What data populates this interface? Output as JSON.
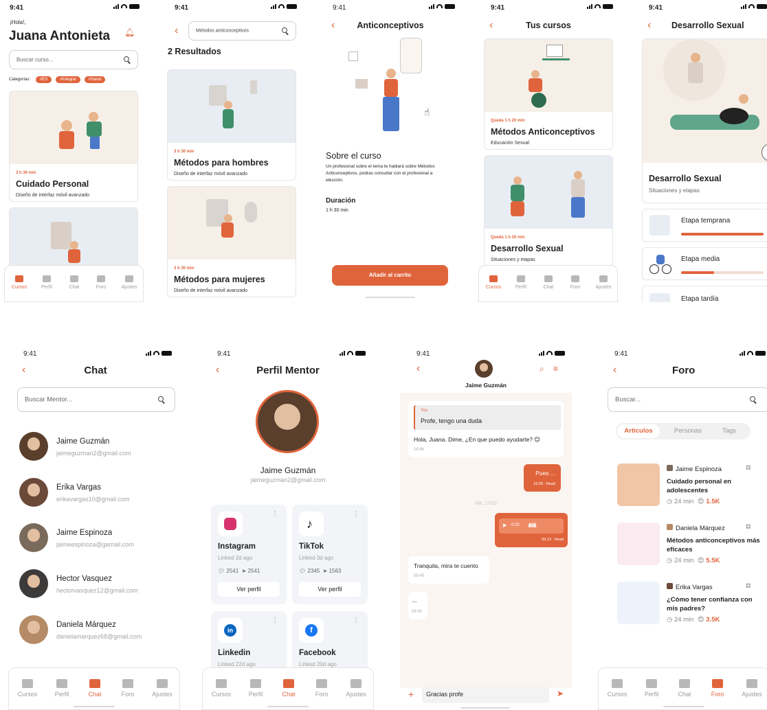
{
  "status_time": "9:41",
  "screens": {
    "home": {
      "greeting": "¡Hola!,",
      "name": "Juana Antonieta",
      "search_placeholder": "Buscar curso...",
      "categories_label": "Categorías:",
      "tags": [
        "#ES",
        "#Integral",
        "#Salud"
      ],
      "course": {
        "duration": "3 h 30 min",
        "title": "Cuidado Personal",
        "subtitle": "Diseño de interfaz móvil avanzado"
      }
    },
    "results": {
      "search_value": "Métodos anticonceptivos",
      "results_title": "2 Resultados",
      "cards": [
        {
          "duration": "3 h 30 min",
          "title": "Métodos para hombres",
          "subtitle": "Diseño de interfaz móvil avanzado"
        },
        {
          "duration": "3 h 30 min",
          "title": "Métodos para mujeres",
          "subtitle": "Diseño de interfaz móvil avanzado"
        }
      ]
    },
    "detail": {
      "title": "Anticonceptivos",
      "about_title": "Sobre el curso",
      "about_text": "Un profesional sobre el tema te hablará sobre Métodos Anticonceptivos, podras consultar con el profesional a elección.",
      "duration_title": "Duración",
      "duration_value": "1 h 30 min",
      "cta": "Añadir al carrito"
    },
    "my_courses": {
      "title": "Tus cursos",
      "cards": [
        {
          "remaining": "Queda 1 h 20 min",
          "title": "Métodos Anticonceptivos",
          "subtitle": "Educación Sexual"
        },
        {
          "remaining": "Queda 1 h 20 min",
          "title": "Desarrollo Sexual",
          "subtitle": "Situaciones y etapas"
        }
      ]
    },
    "development": {
      "title": "Desarrollo Sexual",
      "card_title": "Desarrollo Sexual",
      "card_subtitle": "Situaciones y etapas",
      "stages": [
        {
          "label": "Etapa temprana",
          "progress": 1.0
        },
        {
          "label": "Etapa media",
          "progress": 0.4
        },
        {
          "label": "Etapa tardía",
          "progress": 0
        }
      ]
    },
    "chat": {
      "title": "Chat",
      "search_placeholder": "Buscar Mentor...",
      "mentors": [
        {
          "name": "Jaime Guzmán",
          "email": "jaimeguzman2@gmail.com"
        },
        {
          "name": "Erika Vargas",
          "email": "erikavargas10@gmail.com"
        },
        {
          "name": "Jaime Espinoza",
          "email": "jaimeespinoza@gamail.com"
        },
        {
          "name": "Hector Vasquez",
          "email": "hectorvasquez12@gmail.com"
        },
        {
          "name": "Daniela Márquez",
          "email": "danielamarquez68@gmail.com"
        }
      ]
    },
    "profile": {
      "title": "Perfil Mentor",
      "name": "Jaime Guzmán",
      "email": "jaimeguzman2@gmail.com",
      "socials": [
        {
          "name": "Instagram",
          "linked": "Linked 2d ago",
          "comments": "2541",
          "shares": "2541",
          "button": "Ver perfil",
          "color": "#d6336c"
        },
        {
          "name": "TikTok",
          "linked": "Linked 3d ago",
          "comments": "2345",
          "shares": "1563",
          "button": "Ver perfil",
          "color": "#111111"
        },
        {
          "name": "Linkedin",
          "linked": "Linked 22d ago",
          "color": "#0a66c2"
        },
        {
          "name": "Facebook",
          "linked": "Linked 20d ago",
          "color": "#1877f2"
        }
      ]
    },
    "conversation": {
      "contact": "Jaime Guzmán",
      "quote_label": "You",
      "quote_text": "Profe, tengo una duda",
      "reply": "Hola, Juana. Dime, ¿En que puedo ayudarte? 😊",
      "reply_time": "16:46",
      "sent_text": "Pues ...",
      "sent_time": "16.50 · Read",
      "day_divider": "Vie, 17/10",
      "audio_time": "0:20",
      "audio_meta": "09.13 · Read",
      "msg2": "Tranquila, mira te cuento",
      "msg2_time": "09.45",
      "typing": "...",
      "typing_time": "09.45",
      "input_value": "Gracias profe"
    },
    "forum": {
      "title": "Foro",
      "search_placeholder": "Buscar...",
      "tabs": [
        "Articulos",
        "Personas",
        "Tags"
      ],
      "items": [
        {
          "author": "Jaime Espinoza",
          "title": "Cuidado personal en adolescentes",
          "time": "24 min",
          "likes": "1.5K"
        },
        {
          "author": "Daniela Márquez",
          "title": "Métodos anticonceptivos más eficaces",
          "time": "24 min",
          "likes": "5.5K"
        },
        {
          "author": "Erika Vargas",
          "title": "¿Cómo tener confianza con mis padres?",
          "time": "24 min",
          "likes": "3.5K"
        }
      ]
    }
  },
  "nav": [
    "Cursos",
    "Perfil",
    "Chat",
    "Foro",
    "Ajustes"
  ],
  "colors": {
    "accent": "#e0643b",
    "illus_bg_warm": "#f6efe8",
    "illus_bg_cool": "#e8edf3"
  }
}
